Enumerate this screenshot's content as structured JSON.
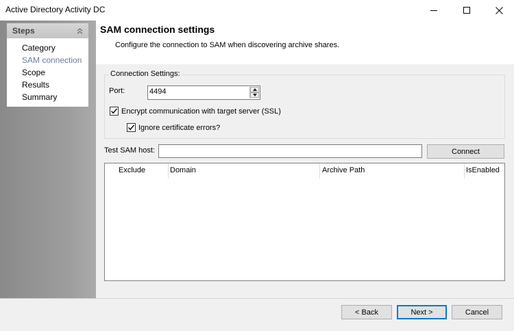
{
  "window": {
    "title": "Active Directory Activity DC"
  },
  "steps": {
    "header": "Steps",
    "items": [
      {
        "label": "Category"
      },
      {
        "label": "SAM connection"
      },
      {
        "label": "Scope"
      },
      {
        "label": "Results"
      },
      {
        "label": "Summary"
      }
    ]
  },
  "header": {
    "title": "SAM connection settings",
    "description": "Configure the connection to SAM when discovering archive shares."
  },
  "connection": {
    "legend": "Connection Settings:",
    "port_label": "Port:",
    "port_value": "4494",
    "ssl_label": "Encrypt communication with target server (SSL)",
    "cert_label": "Ignore certificate errors?"
  },
  "test": {
    "label": "Test SAM host:",
    "value": "",
    "connect_label": "Connect"
  },
  "table": {
    "columns": [
      "Exclude",
      "Domain",
      "Archive Path",
      "IsEnabled"
    ]
  },
  "footer": {
    "back_label": "< Back",
    "next_label": "Next >",
    "cancel_label": "Cancel"
  }
}
